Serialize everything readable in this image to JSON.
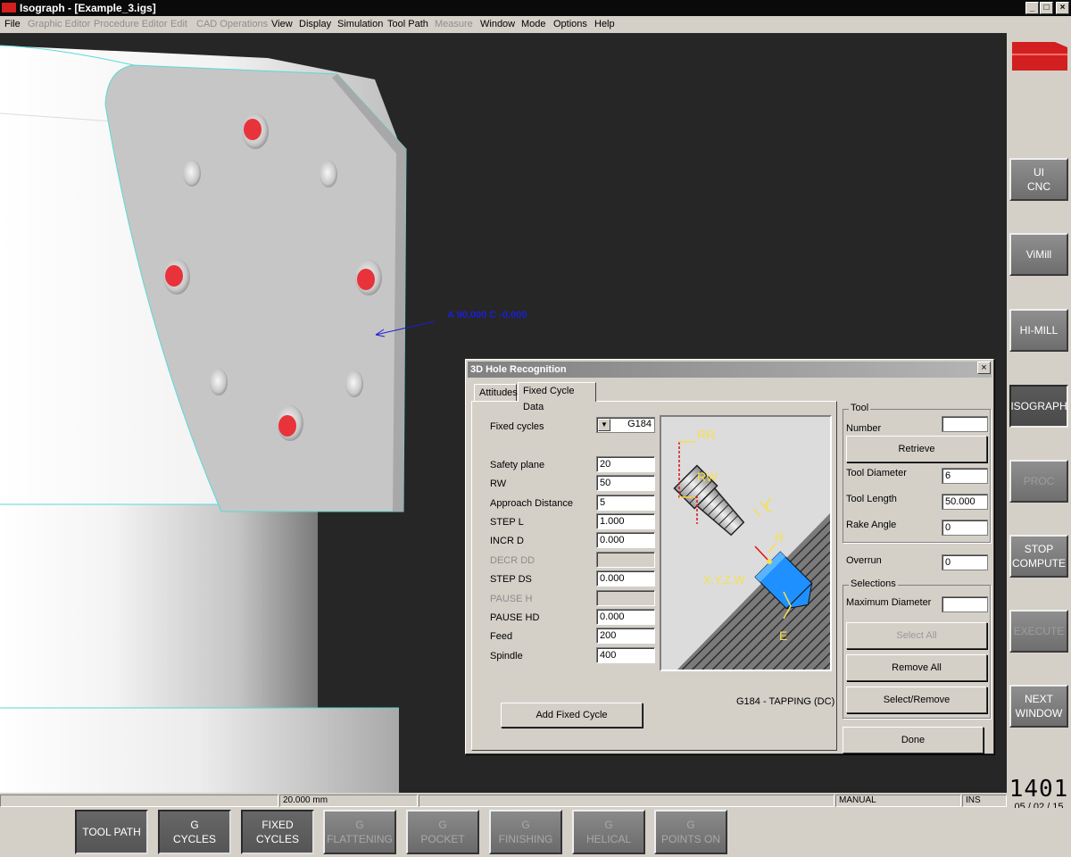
{
  "window": {
    "title": "Isograph - [Example_3.igs]",
    "controls": [
      "_",
      "□",
      "×"
    ]
  },
  "menu": [
    {
      "label": "File",
      "enabled": true
    },
    {
      "label": "Graphic Editor",
      "enabled": false
    },
    {
      "label": "Procedure Editor",
      "enabled": false
    },
    {
      "label": "Edit",
      "enabled": false
    },
    {
      "label": "CAD Operations",
      "enabled": false
    },
    {
      "label": "View",
      "enabled": true
    },
    {
      "label": "Display",
      "enabled": true
    },
    {
      "label": "Simulation",
      "enabled": true
    },
    {
      "label": "Tool Path",
      "enabled": true
    },
    {
      "label": "Measure",
      "enabled": false
    },
    {
      "label": "Window",
      "enabled": true
    },
    {
      "label": "Mode",
      "enabled": true
    },
    {
      "label": "Options",
      "enabled": true
    },
    {
      "label": "Help",
      "enabled": true
    }
  ],
  "viewport": {
    "annotation": "A 90.000 C -0.000",
    "colors": {
      "background": "#262626",
      "hole_highlight": "#e8333b",
      "edge": "#5ad8d8"
    }
  },
  "dialog": {
    "title": "3D Hole Recognition",
    "close": "×",
    "tabs": [
      {
        "label": "Attitudes",
        "active": false
      },
      {
        "label": "Fixed Cycle Data",
        "active": true
      }
    ],
    "fixed_cycles": {
      "label": "Fixed cycles",
      "value": "G184",
      "dropdown": "▼"
    },
    "fields": [
      {
        "label": "Safety plane",
        "value": "20",
        "enabled": true
      },
      {
        "label": "RW",
        "value": "50",
        "enabled": true
      },
      {
        "label": "Approach Distance",
        "value": "5",
        "enabled": true
      },
      {
        "label": "STEP L",
        "value": "1.000",
        "enabled": true
      },
      {
        "label": "INCR D",
        "value": "0.000",
        "enabled": true
      },
      {
        "label": "DECR DD",
        "value": "",
        "enabled": false
      },
      {
        "label": "STEP DS",
        "value": "0.000",
        "enabled": true
      },
      {
        "label": "PAUSE H",
        "value": "",
        "enabled": false
      },
      {
        "label": "PAUSE HD",
        "value": "0.000",
        "enabled": true
      },
      {
        "label": "Feed",
        "value": "200",
        "enabled": true
      },
      {
        "label": "Spindle",
        "value": "400",
        "enabled": true
      }
    ],
    "diagram_labels": {
      "rr": "RR",
      "rw": "RW",
      "l": "L",
      "r": "R",
      "xyzw": "X,Y,Z,W",
      "e": "E"
    },
    "cycle_caption": "G184 - TAPPING (DC)",
    "add_button": "Add Fixed Cycle",
    "tool": {
      "group": "Tool",
      "number_label": "Number",
      "number_value": "",
      "retrieve": "Retrieve",
      "diameter_label": "Tool Diameter",
      "diameter_value": "6",
      "length_label": "Tool Length",
      "length_value": "50.000",
      "rake_label": "Rake Angle",
      "rake_value": "0"
    },
    "overrun": {
      "label": "Overrun",
      "value": "0"
    },
    "selections": {
      "group": "Selections",
      "max_label": "Maximum Diameter",
      "max_value": "",
      "select_all": "Select All",
      "remove_all": "Remove All",
      "select_remove": "Select/Remove"
    },
    "done": "Done"
  },
  "sidebar": [
    {
      "label": "UI\nCNC",
      "state": "normal"
    },
    {
      "label": "ViMill",
      "state": "normal"
    },
    {
      "label": "HI-MILL",
      "state": "normal"
    },
    {
      "label": "ISOGRAPH",
      "state": "active"
    },
    {
      "label": "PROC",
      "state": "disabled"
    },
    {
      "label": "STOP\nCOMPUTE",
      "state": "normal"
    },
    {
      "label": "EXECUTE",
      "state": "disabled"
    },
    {
      "label": "NEXT\nWINDOW",
      "state": "normal"
    }
  ],
  "clock": {
    "time": "1401",
    "date": "05 / 02 / 15"
  },
  "status": {
    "scale": "20.000 mm",
    "mode": "MANUAL",
    "ins": "INS"
  },
  "bottom": [
    {
      "label": "TOOL PATH",
      "state": "active"
    },
    {
      "label": "G\nCYCLES",
      "state": "active"
    },
    {
      "label": "FIXED\nCYCLES",
      "state": "active"
    },
    {
      "label": "G\nFLATTENING",
      "state": "disabled"
    },
    {
      "label": "G\nPOCKET",
      "state": "disabled"
    },
    {
      "label": "G\nFINISHING",
      "state": "disabled"
    },
    {
      "label": "G\nHELICAL",
      "state": "disabled"
    },
    {
      "label": "G\nPOINTS ON",
      "state": "disabled"
    }
  ]
}
